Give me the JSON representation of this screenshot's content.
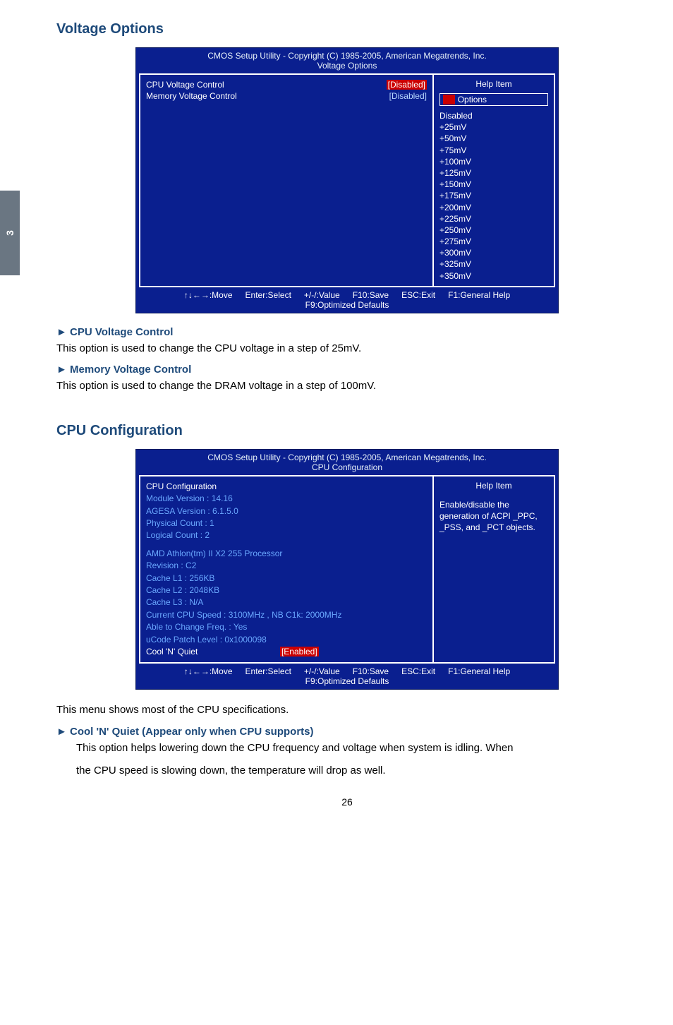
{
  "tab_number": "3",
  "page_number": "26",
  "sections": {
    "voltage": {
      "title": "Voltage Options",
      "bios": {
        "titleLine1": "CMOS Setup Utility - Copyright (C) 1985-2005, American Megatrends, Inc.",
        "titleLine2": "Voltage Options",
        "left": {
          "row0_label": "CPU Voltage Control",
          "row0_value": "[Disabled]",
          "row1_label": "Memory Voltage Control",
          "row1_value": "[Disabled]"
        },
        "right": {
          "help": "Help Item",
          "optionsLabel": "Options",
          "opts": [
            "Disabled",
            "+25mV",
            "+50mV",
            "+75mV",
            "+100mV",
            "+125mV",
            "+150mV",
            "+175mV",
            "+200mV",
            "+225mV",
            "+250mV",
            "+275mV",
            "+300mV",
            "+325mV",
            "+350mV"
          ]
        },
        "footer": {
          "move": "↑↓←→:Move",
          "enter": "Enter:Select",
          "value": "+/-/:Value",
          "save": "F10:Save",
          "esc": "ESC:Exit",
          "f1": "F1:General Help",
          "f9": "F9:Optimized Defaults"
        }
      },
      "item1_head": "► CPU Voltage Control",
      "item1_text": "This option is used to change the CPU voltage in a step of 25mV.",
      "item2_head": "► Memory Voltage Control",
      "item2_text": "This option is used to change the DRAM voltage in a step of 100mV."
    },
    "cpu": {
      "title": "CPU Configuration",
      "bios": {
        "titleLine1": "CMOS Setup Utility - Copyright (C) 1985-2005, American Megatrends, Inc.",
        "titleLine2": "CPU Configuration",
        "left": {
          "l0": "CPU Configuration",
          "l1": "Module Version :  14.16",
          "l2": "AGESA  Version :  6.1.5.0",
          "l3": "Physical Count :   1",
          "l4": "Logical Count    :   2",
          "l5": "AMD Athlon(tm) II X2 255 Processor",
          "l6": "Revision :   C2",
          "l7": "Cache L1 :   256KB",
          "l8": "Cache L2 :   2048KB",
          "l9": "Cache L3  :   N/A",
          "l10": "Current CPU Speed   : 3100MHz ,    NB C1k:  2000MHz",
          "l11": "Able to Change Freq.         : Yes",
          "l12": "uCode Patch Level             : 0x1000098",
          "l13a": "Cool 'N' Quiet",
          "l13b": "[Enabled]"
        },
        "right": {
          "help": "Help Item",
          "text": "Enable/disable the generation of ACPI _PPC, _PSS, and _PCT objects."
        },
        "footer": {
          "move": "↑↓←→:Move",
          "enter": "Enter:Select",
          "value": "+/-/:Value",
          "save": "F10:Save",
          "esc": "ESC:Exit",
          "f1": "F1:General Help",
          "f9": "F9:Optimized Defaults"
        }
      },
      "desc": "This menu shows most of the CPU specifications.",
      "item1_head": "► Cool 'N' Quiet (Appear only when CPU supports)",
      "item1_text1": "This option helps lowering down the CPU frequency and voltage when system is idling. When",
      "item1_text2": "the CPU speed is slowing down, the temperature will drop as well."
    }
  }
}
